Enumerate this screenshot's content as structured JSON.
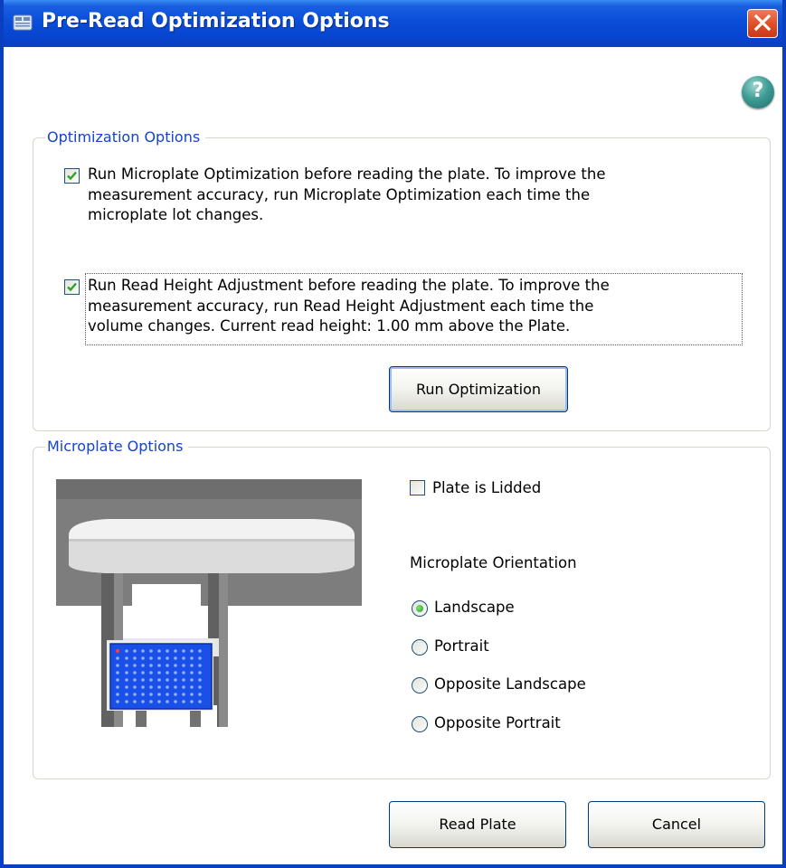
{
  "window": {
    "title": "Pre-Read Optimization Options",
    "title_icon": "app-icon",
    "close_icon": "close-icon",
    "titlebar_color": "#0a4ed8"
  },
  "help": {
    "glyph": "?",
    "icon": "help-icon"
  },
  "optimization_group": {
    "legend": "Optimization Options",
    "microplate_optimization": {
      "checked": true,
      "lines": [
        "Run Microplate Optimization before reading the plate. To improve the",
        "measurement accuracy, run Microplate Optimization each time the",
        "microplate lot changes."
      ]
    },
    "read_height": {
      "checked": true,
      "lines": [
        "Run Read Height Adjustment before reading the plate. To improve the",
        "measurement accuracy, run Read Height Adjustment each time the",
        "volume changes. Current read height: 1.00 mm above the Plate."
      ]
    },
    "run_button": "Run Optimization"
  },
  "microplate_group": {
    "legend": "Microplate Options",
    "lidded": {
      "label": "Plate is Lidded",
      "checked": false
    },
    "orientation_heading": "Microplate Orientation",
    "orientations": [
      {
        "label": "Landscape",
        "selected": true
      },
      {
        "label": "Portrait",
        "selected": false
      },
      {
        "label": "Opposite Landscape",
        "selected": false
      },
      {
        "label": "Opposite Portrait",
        "selected": false
      }
    ],
    "illustration": "microplate-reader-illustration",
    "plate_color": "#1a4fe8"
  },
  "footer": {
    "read_button": "Read Plate",
    "cancel_button": "Cancel"
  },
  "colors": {
    "accent_label": "#1543cb",
    "check_mark": "#2aa52a"
  }
}
